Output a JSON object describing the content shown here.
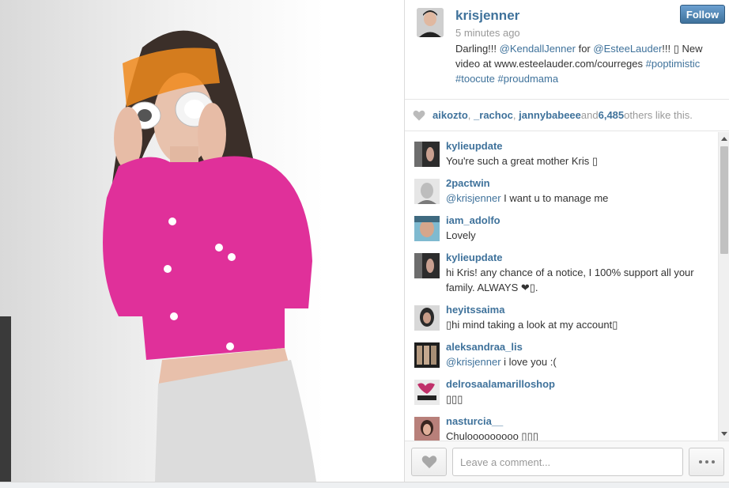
{
  "post": {
    "username": "krisjenner",
    "time_ago": "5 minutes ago",
    "follow_label": "Follow",
    "caption": {
      "part1": "Darling!!! ",
      "mention1": "@KendallJenner",
      "part2": " for ",
      "mention2": "@EsteeLauder",
      "part3": "!!! ▯ New video at www.esteelauder.com/courreges ",
      "tag1": "#poptimistic",
      "tag2": "#toocute",
      "tag3": "#proudmama"
    }
  },
  "likes": {
    "user1": "aikozto",
    "user2": "_rachoc",
    "user3": "jannybabeee",
    "and_text": " and ",
    "count": "6,485",
    "suffix": " others like this."
  },
  "comments": [
    {
      "user": "kylieupdate",
      "text": "You're such a great mother Kris ▯"
    },
    {
      "user": "2pactwin",
      "mention": "@krisjenner",
      "text": " I want u to manage me"
    },
    {
      "user": "iam_adolfo",
      "text": "Lovely"
    },
    {
      "user": "kylieupdate",
      "text": "hi Kris! any chance of a notice, I 100% support all your family. ALWAYS ❤▯."
    },
    {
      "user": "heyitssaima",
      "text": "▯hi mind taking a look at my account▯"
    },
    {
      "user": "aleksandraa_lis",
      "mention": "@krisjenner",
      "text": " i love you :("
    },
    {
      "user": "delrosaalamarilloshop",
      "text": "▯▯▯"
    },
    {
      "user": "nasturcia__",
      "text": "Chulooooooooo ▯▯▯"
    }
  ],
  "footer": {
    "comment_placeholder": "Leave a comment..."
  },
  "icons": {
    "like": "heart-icon",
    "more": "ellipsis-icon"
  },
  "colors": {
    "link": "#3f729b",
    "follow_bg": "#3f729b",
    "jacket": "#e0309a",
    "visor": "#f08a1c"
  }
}
